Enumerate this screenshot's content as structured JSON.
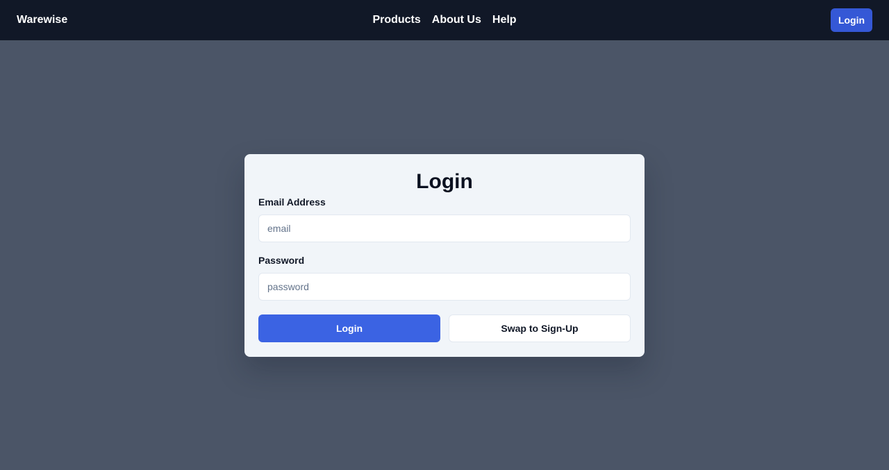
{
  "header": {
    "brand": "Warewise",
    "nav": [
      {
        "label": "Products"
      },
      {
        "label": "About Us"
      },
      {
        "label": "Help"
      }
    ],
    "login_label": "Login"
  },
  "login_form": {
    "title": "Login",
    "email": {
      "label": "Email Address",
      "value": "",
      "placeholder": "email"
    },
    "password": {
      "label": "Password",
      "value": "",
      "placeholder": "password"
    },
    "submit_label": "Login",
    "swap_label": "Swap to Sign-Up"
  },
  "colors": {
    "navbar_bg": "#111827",
    "page_bg": "#4b5567",
    "card_bg": "#f1f5f9",
    "primary": "#3b63e3"
  }
}
